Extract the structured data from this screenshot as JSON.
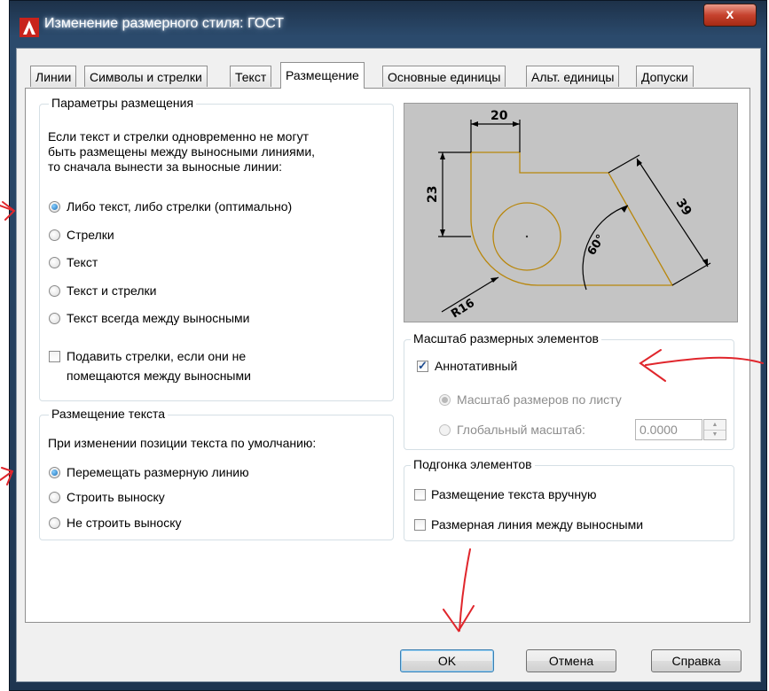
{
  "window": {
    "title": "Изменение размерного стиля: ГОСТ",
    "close_label": "x",
    "accent": "#c6422e"
  },
  "tabs": [
    {
      "label": "Линии",
      "active": false
    },
    {
      "label": "Символы и стрелки",
      "active": false
    },
    {
      "label": "Текст",
      "active": false
    },
    {
      "label": "Размещение",
      "active": true
    },
    {
      "label": "Основные единицы",
      "active": false
    },
    {
      "label": "Альт. единицы",
      "active": false
    },
    {
      "label": "Допуски",
      "active": false
    }
  ],
  "fit_options": {
    "legend": "Параметры размещения",
    "description": [
      "Если текст и стрелки одновременно не могут",
      "быть размещены между выносными линиями,",
      "то сначала вынести за выносные линии:"
    ],
    "radios": [
      {
        "label": "Либо текст, либо стрелки (оптимально)",
        "checked": true
      },
      {
        "label": "Стрелки",
        "checked": false
      },
      {
        "label": "Текст",
        "checked": false
      },
      {
        "label": "Текст и стрелки",
        "checked": false
      },
      {
        "label": "Текст всегда между выносными",
        "checked": false
      }
    ],
    "suppress": {
      "line1": "Подавить стрелки, если они не",
      "line2": "помещаются между выносными",
      "checked": false
    }
  },
  "text_placement": {
    "legend": "Размещение текста",
    "description": "При изменении позиции текста по умолчанию:",
    "radios": [
      {
        "label": "Перемещать размерную линию",
        "checked": true
      },
      {
        "label": "Строить выноску",
        "checked": false
      },
      {
        "label": "Не строить выноску",
        "checked": false
      }
    ]
  },
  "preview": {
    "dim_top": "20",
    "dim_left": "23",
    "dim_diag": "39",
    "dim_angle": "60°",
    "dim_radius": "R16"
  },
  "scale": {
    "legend": "Масштаб размерных элементов",
    "annotative": {
      "label": "Аннотативный",
      "checked": true
    },
    "radios": [
      {
        "label": "Масштаб размеров по листу",
        "checked": true
      },
      {
        "label": "Глобальный масштаб:",
        "checked": false
      }
    ],
    "global_value": "0.0000"
  },
  "fine_tuning": {
    "legend": "Подгонка элементов",
    "checks": [
      {
        "label": "Размещение текста вручную",
        "checked": false
      },
      {
        "label": "Размерная линия между выносными",
        "checked": false
      }
    ]
  },
  "buttons": {
    "ok": "OK",
    "cancel": "Отмена",
    "help": "Справка"
  }
}
